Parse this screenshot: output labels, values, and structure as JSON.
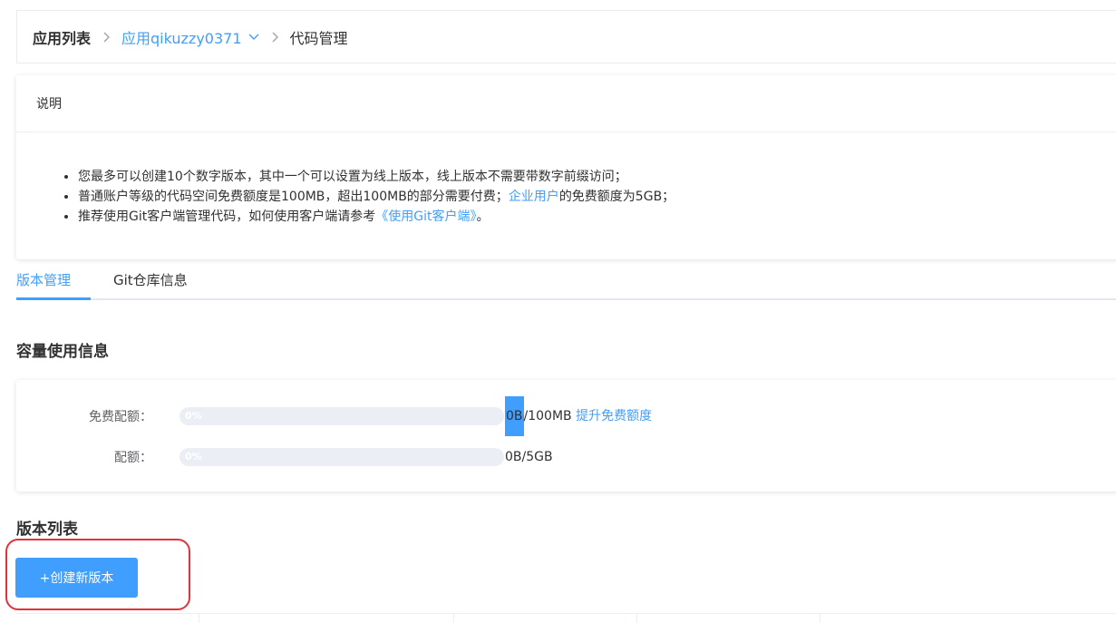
{
  "breadcrumb": {
    "root": "应用列表",
    "app": "应用qikuzzy0371",
    "current": "代码管理"
  },
  "note": {
    "title": "说明",
    "line1": "您最多可以创建10个数字版本，其中一个可以设置为线上版本，线上版本不需要带数字前缀访问；",
    "line2_pre": "普通账户等级的代码空间免费额度是100MB，超出100MB的部分需要付费；",
    "line2_link": "企业用户",
    "line2_post": "的免费额度为5GB；",
    "line3_pre": "推荐使用Git客户端管理代码，如何使用客户端请参考",
    "line3_link": "《使用Git客户端》",
    "line3_post": "。"
  },
  "tabs": [
    {
      "label": "版本管理",
      "active": true
    },
    {
      "label": "Git仓库信息",
      "active": false
    }
  ],
  "quota": {
    "title": "容量使用信息",
    "free_label": "免费配额：",
    "free_percent_text": "0%",
    "free_percent": 0,
    "free_used": "0B",
    "free_total": "/100MB",
    "upgrade_link": "提升免费额度",
    "quota_label": "配额：",
    "quota_percent_text": "0%",
    "quota_percent": 0,
    "quota_value": "0B/5GB"
  },
  "versions": {
    "title": "版本列表",
    "create_button": "+创建新版本"
  },
  "colors": {
    "accent": "#409eff",
    "annotation": "#e0343a"
  }
}
